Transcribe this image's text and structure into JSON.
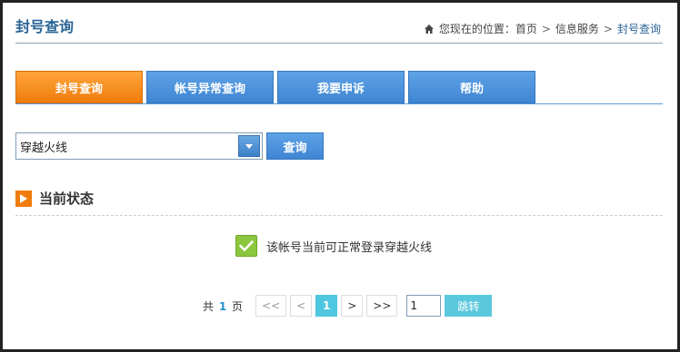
{
  "header": {
    "title": "封号查询",
    "breadcrumb": {
      "icon": "home-icon",
      "prefix": "您现在的位置：",
      "items": [
        "首页",
        "信息服务",
        "封号查询"
      ],
      "separator": ">"
    }
  },
  "tabs": [
    {
      "label": "封号查询",
      "active": true
    },
    {
      "label": "帐号异常查询",
      "active": false
    },
    {
      "label": "我要申诉",
      "active": false
    },
    {
      "label": "帮助",
      "active": false
    }
  ],
  "query": {
    "selected_game": "穿越火线",
    "button_label": "查询"
  },
  "status": {
    "section_title": "当前状态",
    "message": "该帐号当前可正常登录穿越火线",
    "icon": "check-icon"
  },
  "pagination": {
    "total_prefix": "共",
    "total_pages": "1",
    "total_suffix": "页",
    "first": "<<",
    "prev": "<",
    "current": "1",
    "next": ">",
    "last": ">>",
    "input_value": "1",
    "jump_label": "跳转"
  },
  "colors": {
    "accent_orange": "#f07c0c",
    "accent_blue": "#3f86d3",
    "title_blue": "#2a6496",
    "success_green": "#8cc63f",
    "pager_cyan": "#4fc7e0"
  }
}
